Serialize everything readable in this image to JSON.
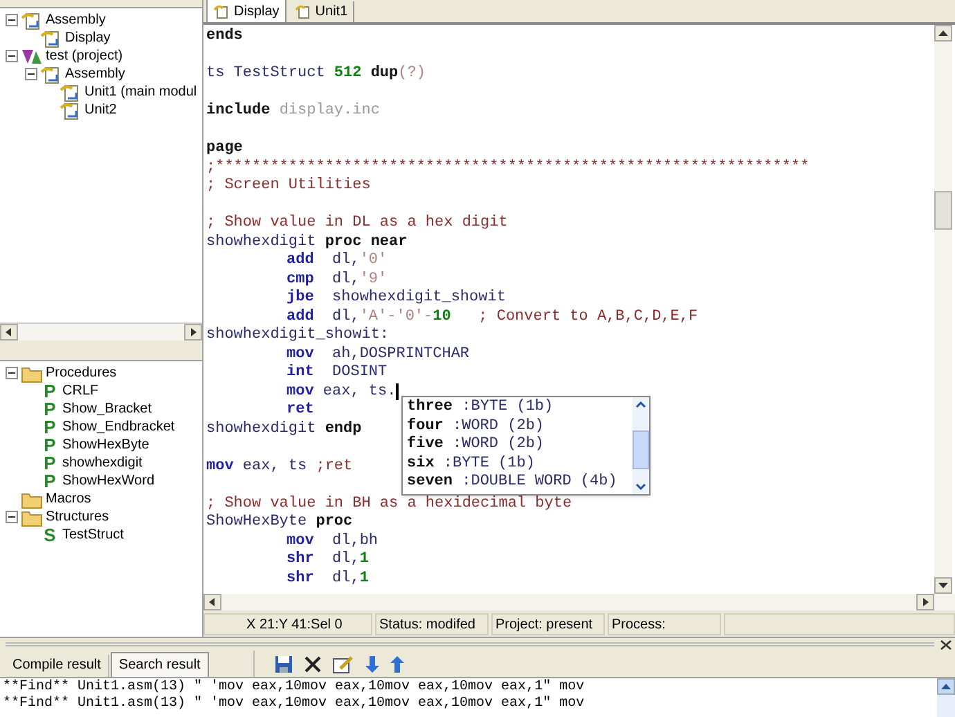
{
  "project_tree": [
    {
      "label": "Assembly",
      "kind": "module",
      "expanded": true,
      "children": [
        {
          "label": "Display",
          "kind": "module"
        }
      ]
    },
    {
      "label": "test (project)",
      "kind": "project",
      "expanded": true,
      "children": [
        {
          "label": "Assembly",
          "kind": "module",
          "expanded": true,
          "children": [
            {
              "label": "Unit1 (main modul",
              "kind": "module"
            },
            {
              "label": "Unit2",
              "kind": "module"
            }
          ]
        }
      ]
    }
  ],
  "symbol_tree": [
    {
      "label": "Procedures",
      "kind": "folder",
      "expanded": true,
      "children": [
        {
          "label": "CRLF",
          "kind": "symbol",
          "letter": "P"
        },
        {
          "label": "Show_Bracket",
          "kind": "symbol",
          "letter": "P"
        },
        {
          "label": "Show_Endbracket",
          "kind": "symbol",
          "letter": "P"
        },
        {
          "label": "ShowHexByte",
          "kind": "symbol",
          "letter": "P"
        },
        {
          "label": "showhexdigit",
          "kind": "symbol",
          "letter": "P"
        },
        {
          "label": "ShowHexWord",
          "kind": "symbol",
          "letter": "P"
        }
      ]
    },
    {
      "label": "Macros",
      "kind": "folder"
    },
    {
      "label": "Structures",
      "kind": "folder",
      "expanded": true,
      "children": [
        {
          "label": "TestStruct",
          "kind": "symbol",
          "letter": "S"
        }
      ]
    }
  ],
  "editor_tabs": [
    {
      "label": "Display",
      "selected": true
    },
    {
      "label": "Unit1",
      "selected": false
    }
  ],
  "code_lines": [
    {
      "kind": "flush",
      "tokens": [
        {
          "kind": "keyword",
          "text": "ends"
        }
      ]
    },
    {
      "kind": "blank"
    },
    {
      "kind": "flush",
      "tokens": [
        {
          "kind": "plain",
          "text": "ts TestStruct "
        },
        {
          "kind": "number",
          "text": "512"
        },
        {
          "kind": "keyword",
          "text": " dup"
        },
        {
          "kind": "string",
          "text": "(?)"
        }
      ]
    },
    {
      "kind": "blank"
    },
    {
      "kind": "flush",
      "tokens": [
        {
          "kind": "keyword",
          "text": "include"
        },
        {
          "kind": "file",
          "text": " display.inc"
        }
      ]
    },
    {
      "kind": "blank"
    },
    {
      "kind": "flush",
      "tokens": [
        {
          "kind": "keyword",
          "text": "page"
        }
      ]
    },
    {
      "kind": "flush",
      "tokens": [
        {
          "kind": "comment",
          "text": ";*****************************************************************"
        }
      ]
    },
    {
      "kind": "flush",
      "tokens": [
        {
          "kind": "comment",
          "text": "; Screen Utilities"
        }
      ]
    },
    {
      "kind": "blank"
    },
    {
      "kind": "flush",
      "tokens": [
        {
          "kind": "comment",
          "text": "; Show value in DL as a hex digit"
        }
      ]
    },
    {
      "kind": "flush",
      "tokens": [
        {
          "kind": "plain",
          "text": "showhexdigit "
        },
        {
          "kind": "keyword",
          "text": "proc near"
        }
      ]
    },
    {
      "kind": "indented",
      "tokens": [
        {
          "kind": "instruction",
          "text": "add"
        },
        {
          "kind": "plain",
          "text": "  dl,"
        },
        {
          "kind": "string",
          "text": "'0'"
        }
      ]
    },
    {
      "kind": "indented",
      "tokens": [
        {
          "kind": "instruction",
          "text": "cmp"
        },
        {
          "kind": "plain",
          "text": "  dl,"
        },
        {
          "kind": "string",
          "text": "'9'"
        }
      ]
    },
    {
      "kind": "indented",
      "tokens": [
        {
          "kind": "instruction",
          "text": "jbe"
        },
        {
          "kind": "plain",
          "text": "  showhexdigit_showit"
        }
      ]
    },
    {
      "kind": "indented",
      "tokens": [
        {
          "kind": "instruction",
          "text": "add"
        },
        {
          "kind": "plain",
          "text": "  dl,"
        },
        {
          "kind": "string",
          "text": "'A'-'0'-"
        },
        {
          "kind": "number",
          "text": "10"
        },
        {
          "kind": "comment",
          "text": "   ; Convert to A,B,C,D,E,F"
        }
      ]
    },
    {
      "kind": "flush",
      "tokens": [
        {
          "kind": "plain",
          "text": "showhexdigit_showit:"
        }
      ]
    },
    {
      "kind": "indented",
      "tokens": [
        {
          "kind": "instruction",
          "text": "mov"
        },
        {
          "kind": "plain",
          "text": "  ah,DOSPRINTCHAR"
        }
      ]
    },
    {
      "kind": "indented",
      "tokens": [
        {
          "kind": "instruction",
          "text": "int"
        },
        {
          "kind": "plain",
          "text": "  DOSINT"
        }
      ]
    },
    {
      "kind": "indented",
      "cursor": true,
      "tokens": [
        {
          "kind": "instruction",
          "text": "mov"
        },
        {
          "kind": "plain",
          "text": " eax, ts."
        }
      ]
    },
    {
      "kind": "indented",
      "tokens": [
        {
          "kind": "instruction",
          "text": "ret"
        }
      ]
    },
    {
      "kind": "flush",
      "tokens": [
        {
          "kind": "plain",
          "text": "showhexdigit "
        },
        {
          "kind": "keyword",
          "text": "endp"
        }
      ]
    },
    {
      "kind": "blank"
    },
    {
      "kind": "flush",
      "tokens": [
        {
          "kind": "instruction",
          "text": "mov"
        },
        {
          "kind": "plain",
          "text": " eax, ts "
        },
        {
          "kind": "comment",
          "text": ";ret"
        }
      ]
    },
    {
      "kind": "blank"
    },
    {
      "kind": "flush",
      "tokens": [
        {
          "kind": "comment",
          "text": "; Show value in BH as a hexidecimal byte"
        }
      ]
    },
    {
      "kind": "flush",
      "tokens": [
        {
          "kind": "plain",
          "text": "ShowHexByte "
        },
        {
          "kind": "keyword",
          "text": "proc"
        }
      ]
    },
    {
      "kind": "indented",
      "tokens": [
        {
          "kind": "instruction",
          "text": "mov"
        },
        {
          "kind": "plain",
          "text": "  dl,bh"
        }
      ]
    },
    {
      "kind": "indented",
      "tokens": [
        {
          "kind": "instruction",
          "text": "shr"
        },
        {
          "kind": "plain",
          "text": "  dl,"
        },
        {
          "kind": "number",
          "text": "1"
        }
      ]
    },
    {
      "kind": "indented",
      "tokens": [
        {
          "kind": "instruction",
          "text": "shr"
        },
        {
          "kind": "plain",
          "text": "  dl,"
        },
        {
          "kind": "number",
          "text": "1"
        }
      ]
    }
  ],
  "completion_popup": [
    {
      "name": "three",
      "type": ":BYTE (1b)"
    },
    {
      "name": "four",
      "type": ":WORD (2b)"
    },
    {
      "name": "five",
      "type": ":WORD (2b)"
    },
    {
      "name": "six",
      "type": ":BYTE (1b)"
    },
    {
      "name": "seven",
      "type": ":DOUBLE WORD (4b)"
    }
  ],
  "status_bar": [
    "X 21:Y 41:Sel 0",
    "Status: modifed",
    "Project: present",
    "Process:"
  ],
  "output_tabs": [
    {
      "label": "Compile result",
      "selected": false
    },
    {
      "label": "Search result",
      "selected": true
    }
  ],
  "output_lines": [
    "**Find** Unit1.asm(13) \" 'mov eax,10mov eax,10mov eax,10mov eax,1\" mov",
    "**Find** Unit1.asm(13) \" 'mov eax,10mov eax,10mov eax,10mov eax,1\" mov"
  ]
}
